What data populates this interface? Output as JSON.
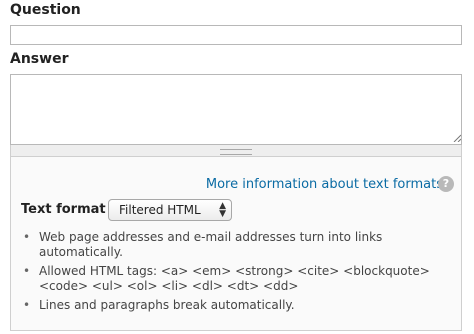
{
  "question": {
    "label": "Question",
    "value": ""
  },
  "answer": {
    "label": "Answer",
    "value": ""
  },
  "text_format": {
    "more_info_link": "More information about text formats",
    "help_icon": "question-icon",
    "label": "Text format",
    "selected": "Filtered HTML",
    "arrow_glyph": "▲▼",
    "tips": [
      "Web page addresses and e-mail addresses turn into links automatically.",
      "Allowed HTML tags: <a> <em> <strong> <cite> <blockquote> <code> <ul> <ol> <li> <dl> <dt> <dd>",
      "Lines and paragraphs break automatically."
    ]
  },
  "colors": {
    "link": "#0a6ba4",
    "border": "#b8b8b8",
    "panel_background": "#fafafa",
    "help_icon_background": "#b9b9b9"
  }
}
